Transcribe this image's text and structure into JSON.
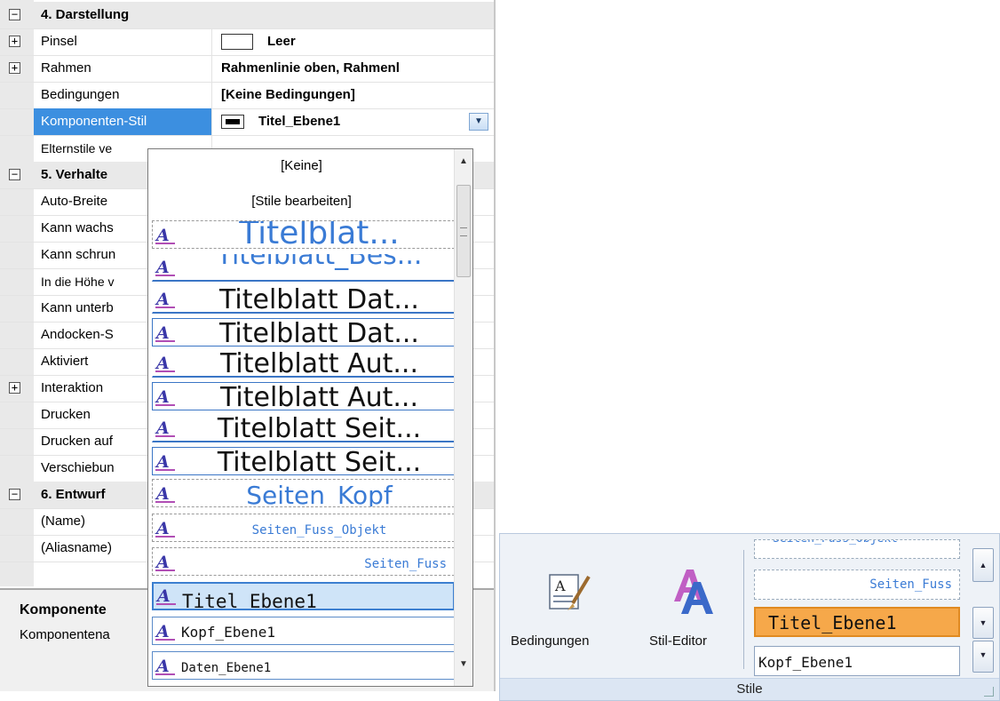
{
  "property_grid": {
    "rows": [
      {
        "type": "category",
        "expander": "−",
        "name": "4. Darstellung"
      },
      {
        "type": "prop",
        "expander": "+",
        "name": "Pinsel",
        "value": "Leer",
        "swatch": "empty"
      },
      {
        "type": "prop",
        "expander": "+",
        "name": "Rahmen",
        "value": "Rahmenlinie oben, Rahmenl"
      },
      {
        "type": "prop",
        "name": "Bedingungen",
        "value": "[Keine Bedingungen]"
      },
      {
        "type": "prop",
        "name": "Komponenten-Stil",
        "value": "Titel_Ebene1",
        "selected": true,
        "swatch": "line",
        "dropdown": true
      },
      {
        "type": "prop",
        "name": "Elternstile ve",
        "small": true
      },
      {
        "type": "category",
        "expander": "−",
        "name": "5. Verhalte"
      },
      {
        "type": "prop",
        "name": "Auto-Breite"
      },
      {
        "type": "prop",
        "name": "Kann wachs"
      },
      {
        "type": "prop",
        "name": "Kann schrun"
      },
      {
        "type": "prop",
        "name": "In die Höhe v",
        "small": true
      },
      {
        "type": "prop",
        "name": "Kann unterb"
      },
      {
        "type": "prop",
        "name": "Andocken-S"
      },
      {
        "type": "prop",
        "name": "Aktiviert"
      },
      {
        "type": "prop",
        "expander": "+",
        "name": "Interaktion"
      },
      {
        "type": "prop",
        "name": "Drucken"
      },
      {
        "type": "prop",
        "name": "Drucken auf"
      },
      {
        "type": "prop",
        "name": "Verschiebun"
      },
      {
        "type": "category",
        "expander": "−",
        "name": "6. Entwurf"
      },
      {
        "type": "prop",
        "name": "(Name)"
      },
      {
        "type": "prop",
        "name": "(Aliasname)"
      }
    ],
    "help": {
      "title": "Komponente",
      "text": "Komponentena"
    }
  },
  "dropdown": {
    "top_options": [
      "[Keine]",
      "[Stile bearbeiten]"
    ],
    "icon_glyph": "A",
    "items": [
      {
        "label": "Titelblat...",
        "size": 36,
        "color": "#3a7bd5",
        "font": "sans",
        "align": "center",
        "frame": "dashed"
      },
      {
        "label": "Titelblatt_Bes...",
        "size": 30,
        "color": "#3a7bd5",
        "font": "sans",
        "align": "center",
        "frame": "uline",
        "clip": true
      },
      {
        "label": "Titelblatt Dat...",
        "size": 30,
        "color": "#111",
        "font": "sans",
        "align": "center",
        "frame": "uline"
      },
      {
        "label": "Titelblatt Dat...",
        "size": 30,
        "color": "#111",
        "font": "sans",
        "align": "center",
        "frame": "obox"
      },
      {
        "label": "Titelblatt Aut...",
        "size": 30,
        "color": "#111",
        "font": "sans",
        "align": "center",
        "frame": "uline"
      },
      {
        "label": "Titelblatt Aut...",
        "size": 30,
        "color": "#111",
        "font": "sans",
        "align": "center",
        "frame": "obox"
      },
      {
        "label": "Titelblatt Seit...",
        "size": 30,
        "color": "#111",
        "font": "sans",
        "align": "center",
        "frame": "uline"
      },
      {
        "label": "Titelblatt Seit...",
        "size": 30,
        "color": "#111",
        "font": "sans",
        "align": "center",
        "frame": "obox"
      },
      {
        "label": "Seiten_Kopf",
        "size": 28,
        "color": "#3a7bd5",
        "font": "sans",
        "align": "center",
        "frame": "dashed"
      },
      {
        "label": "Seiten_Fuss_Objekt",
        "size": 14,
        "color": "#3a7bd5",
        "font": "mono",
        "align": "center",
        "frame": "dashed"
      },
      {
        "label": "Seiten_Fuss",
        "size": 14,
        "color": "#3a7bd5",
        "font": "mono",
        "align": "right",
        "frame": "dashed"
      },
      {
        "label": "Titel_Ebene1",
        "size": 21,
        "color": "#111",
        "font": "mono",
        "align": "left",
        "frame": "selected"
      },
      {
        "label": "Kopf_Ebene1",
        "size": 16,
        "color": "#111",
        "font": "mono",
        "align": "left",
        "frame": "solid"
      },
      {
        "label": "Daten_Ebene1",
        "size": 14,
        "color": "#111",
        "font": "mono",
        "align": "left",
        "frame": "solid"
      }
    ]
  },
  "ribbon": {
    "buttons": [
      {
        "label": "Bedingungen",
        "icon": "conditions-brush-icon"
      },
      {
        "label": "Stil-Editor",
        "icon": "style-editor-icon"
      }
    ],
    "gallery": [
      {
        "label": "Seiten_Fuss_Objekt",
        "style": "partial"
      },
      {
        "label": "Seiten_Fuss",
        "style": "dashed-right"
      },
      {
        "label": "Titel_Ebene1",
        "style": "selected"
      },
      {
        "label": "Kopf_Ebene1",
        "style": "normal"
      }
    ],
    "group_label": "Stile",
    "accent_color": "#f6a84a"
  }
}
